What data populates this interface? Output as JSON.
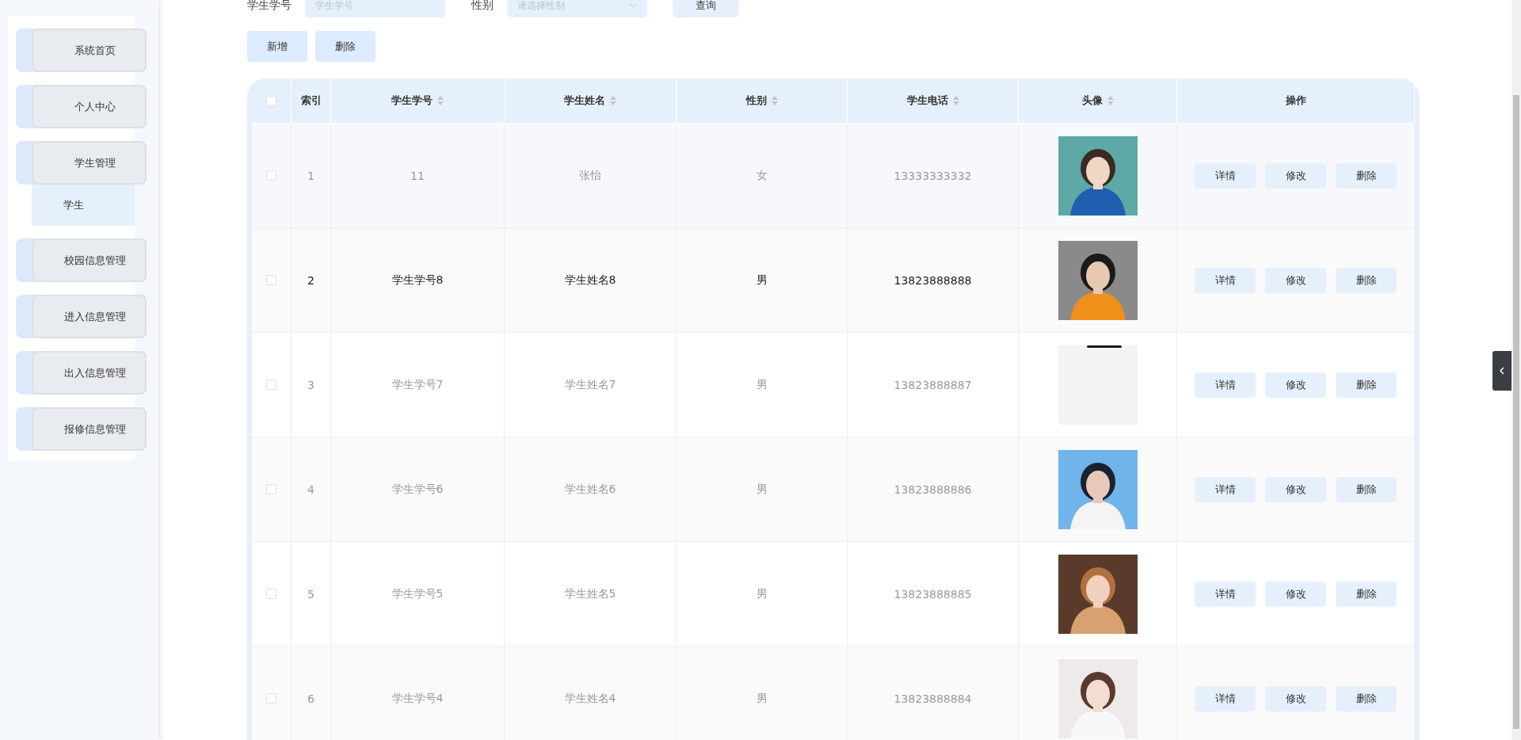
{
  "search": {
    "fields": [
      {
        "label": "学生学号",
        "placeholder": "学生学号",
        "kind": "input"
      },
      {
        "label": "性别",
        "placeholder": "请选择性别",
        "kind": "select"
      }
    ],
    "button": "查询"
  },
  "sidebar": {
    "items": [
      {
        "label": "系统首页"
      },
      {
        "label": "个人中心"
      },
      {
        "label": "学生管理",
        "children": [
          {
            "label": "学生"
          }
        ]
      },
      {
        "label": "校园信息管理"
      },
      {
        "label": "进入信息管理"
      },
      {
        "label": "出入信息管理"
      },
      {
        "label": "报修信息管理"
      }
    ]
  },
  "actions": [
    "新增",
    "删除"
  ],
  "table": {
    "all_checked": false,
    "columns": [
      {
        "label": "索引",
        "sortable": false
      },
      {
        "label": "学生学号",
        "sortable": true
      },
      {
        "label": "学生姓名",
        "sortable": true
      },
      {
        "label": "性别",
        "sortable": true
      },
      {
        "label": "学生电话",
        "sortable": true
      },
      {
        "label": "头像",
        "sortable": true
      },
      {
        "label": "操作",
        "sortable": false
      }
    ],
    "rows": [
      {
        "checked": false,
        "highlighted": false,
        "index": "1",
        "id": "11",
        "name": "张怡",
        "gender": "女",
        "phone": "13333333332",
        "actions": [
          "详情",
          "修改",
          "删除"
        ]
      },
      {
        "checked": false,
        "highlighted": true,
        "index": "2",
        "id": "学生学号8",
        "name": "学生姓名8",
        "gender": "男",
        "phone": "13823888888",
        "actions": [
          "详情",
          "修改",
          "删除"
        ]
      },
      {
        "checked": false,
        "highlighted": false,
        "index": "3",
        "id": "学生学号7",
        "name": "学生姓名7",
        "gender": "男",
        "phone": "13823888887",
        "actions": [
          "详情",
          "修改",
          "删除"
        ]
      },
      {
        "checked": false,
        "highlighted": false,
        "index": "4",
        "id": "学生学号6",
        "name": "学生姓名6",
        "gender": "男",
        "phone": "13823888886",
        "actions": [
          "详情",
          "修改",
          "删除"
        ]
      },
      {
        "checked": false,
        "highlighted": false,
        "index": "5",
        "id": "学生学号5",
        "name": "学生姓名5",
        "gender": "男",
        "phone": "13823888885",
        "actions": [
          "详情",
          "修改",
          "删除"
        ]
      },
      {
        "checked": false,
        "highlighted": false,
        "index": "6",
        "id": "学生学号4",
        "name": "学生姓名4",
        "gender": "男",
        "phone": "13823888884",
        "actions": [
          "详情",
          "修改",
          "删除"
        ]
      }
    ]
  }
}
